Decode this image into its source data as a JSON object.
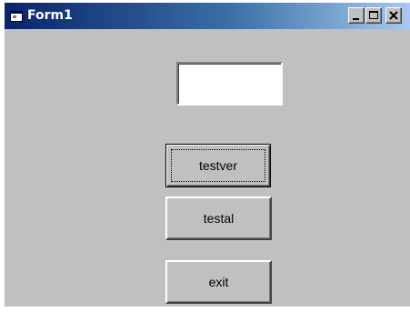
{
  "window": {
    "title": "Form1",
    "icon": "vb-form-icon",
    "controls": {
      "minimize_icon": "minimize-icon",
      "maximize_icon": "maximize-icon",
      "close_icon": "close-icon"
    },
    "colors": {
      "title_start": "#0a246a",
      "title_end": "#a6caf0",
      "face": "#c0c0c0"
    }
  },
  "form": {
    "textbox": {
      "value": ""
    },
    "buttons": {
      "testver": "testver",
      "testal": "testal",
      "exit": "exit"
    }
  }
}
